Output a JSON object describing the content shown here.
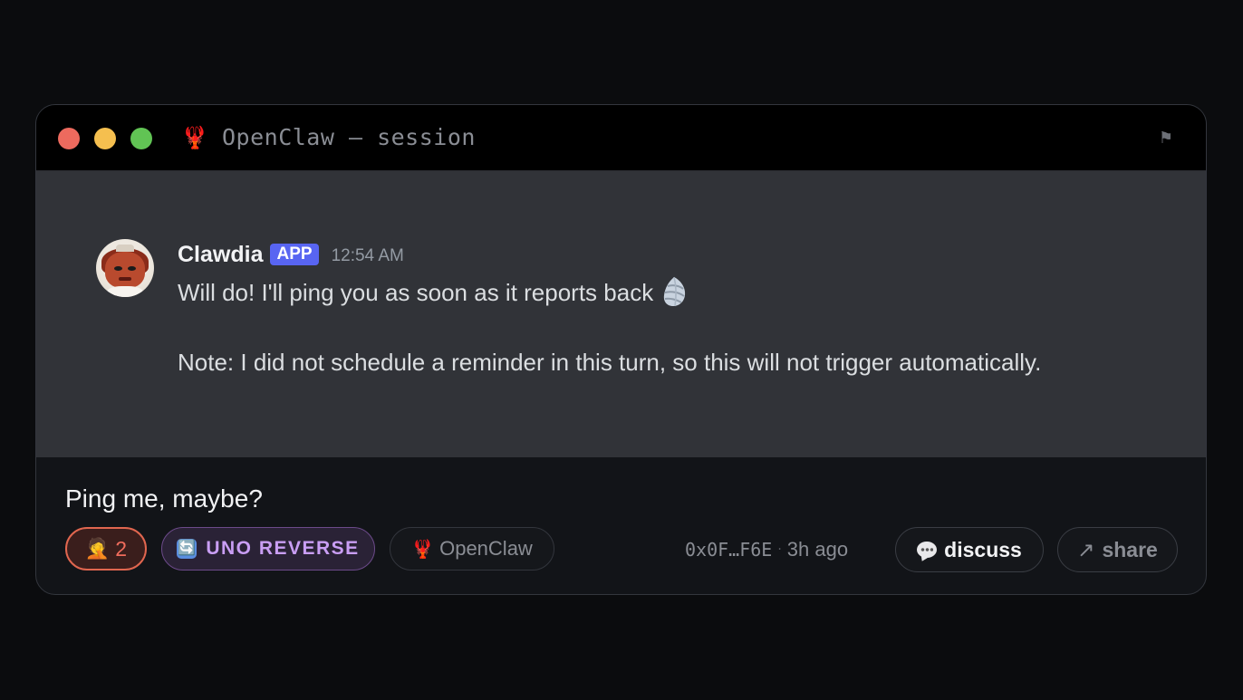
{
  "window": {
    "title": "OpenClaw — session",
    "title_icon": "lobster-icon",
    "flag_icon": "flag-icon",
    "traffic_lights": {
      "red": "#ed6a5e",
      "yellow": "#f5bf4f",
      "green": "#61c454"
    }
  },
  "message": {
    "author": "Clawdia",
    "badge": "APP",
    "timestamp": "12:54 AM",
    "line1": "Will do! I'll ping you as soon as it reports back",
    "line1_emoji": "spiral-shell-icon",
    "line2": "Note: I did not schedule a reminder in this turn, so this will not trigger automatically."
  },
  "footer": {
    "title": "Ping me, maybe?",
    "reaction": {
      "emoji": "facepalm-icon",
      "count": "2"
    },
    "uno": {
      "icon": "counterclockwise-arrows-icon",
      "icon_glyph": "🔄",
      "label": "UNO REVERSE"
    },
    "tag": {
      "icon": "lobster-icon",
      "label": "OpenClaw"
    },
    "address": "0x0F…F6E",
    "separator": "·",
    "ago": "3h ago",
    "discuss_label": "discuss",
    "share_arrow": "↗",
    "share_label": "share"
  },
  "colors": {
    "background": "#0b0c0e",
    "message_panel": "#313338",
    "app_badge": "#5865f2",
    "reaction_accent": "#f06c5c",
    "uno_accent": "#c99ef4"
  }
}
